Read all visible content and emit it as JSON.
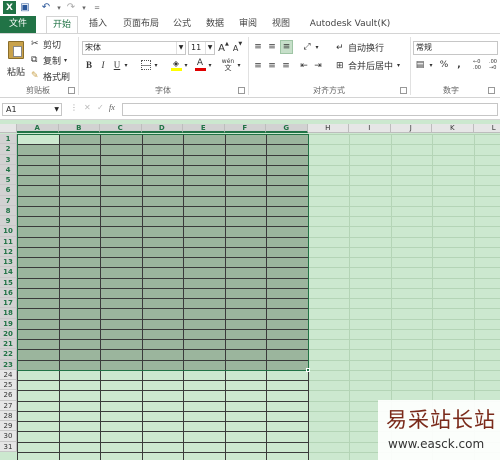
{
  "window": {
    "quick_access": [
      {
        "name": "excel-logo-icon",
        "glyph": "X"
      },
      {
        "name": "save-icon",
        "glyph": "▣"
      },
      {
        "name": "undo-icon",
        "glyph": "↶"
      },
      {
        "name": "undo-dropdown-icon",
        "glyph": "▾"
      },
      {
        "name": "redo-icon",
        "glyph": "↷"
      },
      {
        "name": "redo-dropdown-icon",
        "glyph": "▾"
      },
      {
        "name": "customize-qat-icon",
        "glyph": "="
      }
    ]
  },
  "tabs": [
    {
      "label": "文件",
      "kind": "file"
    },
    {
      "label": "开始",
      "kind": "active"
    },
    {
      "label": "插入",
      "kind": ""
    },
    {
      "label": "页面布局",
      "kind": ""
    },
    {
      "label": "公式",
      "kind": ""
    },
    {
      "label": "数据",
      "kind": ""
    },
    {
      "label": "审阅",
      "kind": ""
    },
    {
      "label": "视图",
      "kind": ""
    },
    {
      "label": "Autodesk Vault(K)",
      "kind": ""
    }
  ],
  "clipboard": {
    "paste_label": "粘贴",
    "cut_label": "剪切",
    "copy_label": "复制",
    "format_painter_label": "格式刷",
    "group_label": "剪贴板"
  },
  "font": {
    "name": "宋体",
    "size": "11",
    "grow_glyph": "A",
    "shrink_glyph": "A",
    "bold_glyph": "B",
    "italic_glyph": "I",
    "underline_glyph": "U",
    "fontcolor_glyph": "A",
    "wen_glyph": "wén",
    "group_label": "字体"
  },
  "alignment": {
    "wrap_label": "自动换行",
    "merge_label": "合并后居中",
    "group_label": "对齐方式"
  },
  "number": {
    "format": "常规",
    "percent_glyph": "%",
    "comma_glyph": ",",
    "group_label": "数字"
  },
  "formula_bar": {
    "name_box": "A1",
    "cancel_glyph": "✕",
    "enter_glyph": "✓",
    "fx_glyph": "fx",
    "content": ""
  },
  "sheet": {
    "columns": [
      "A",
      "B",
      "C",
      "D",
      "E",
      "F",
      "G",
      "H",
      "I",
      "J",
      "K",
      "L"
    ],
    "rows": [
      "1",
      "2",
      "3",
      "4",
      "5",
      "6",
      "7",
      "8",
      "9",
      "10",
      "11",
      "12",
      "13",
      "14",
      "15",
      "16",
      "17",
      "18",
      "19",
      "20",
      "21",
      "22",
      "23",
      "24",
      "25",
      "26",
      "27",
      "28",
      "29",
      "30",
      "31"
    ],
    "selected_columns": [
      "A",
      "B",
      "C",
      "D",
      "E",
      "F",
      "G"
    ],
    "selected_rows_count": 23,
    "bordered_columns": [
      "A",
      "B",
      "C",
      "D",
      "E",
      "F",
      "G"
    ],
    "active_cell": "A1",
    "colors": {
      "sheet_background": "#cce8cf",
      "selection_fill": "#9bb59d",
      "active_cell_fill": "#cce8cf",
      "gridline": "#b4d4b6",
      "border": "#3a3a3a",
      "accent": "#217346"
    }
  },
  "watermark": {
    "title": "易采站长站",
    "url": "www.easck.com"
  }
}
